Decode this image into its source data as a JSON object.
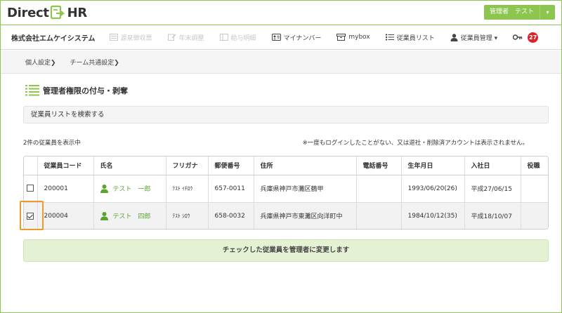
{
  "header": {
    "logo_left": "Direct",
    "logo_right": "HR",
    "admin_label": "管理者　テスト",
    "caret": "▾"
  },
  "nav": {
    "company": "株式会社エムケイシステム",
    "items": [
      {
        "label": "源泉徴収票",
        "icon": "document-icon",
        "disabled": true
      },
      {
        "label": "年末調整",
        "icon": "edit-icon",
        "disabled": true
      },
      {
        "label": "給与明細",
        "icon": "payslip-icon",
        "disabled": true
      },
      {
        "label": "マイナンバー",
        "icon": "id-card-icon",
        "disabled": false
      },
      {
        "label": "mybox",
        "icon": "box-icon",
        "disabled": false
      },
      {
        "label": "従業員リスト",
        "icon": "list-icon",
        "disabled": false
      },
      {
        "label": "従業員管理 ▾",
        "icon": "user-icon",
        "disabled": false
      }
    ],
    "notification_count": "27"
  },
  "subnav": {
    "items": [
      "個人設定❯",
      "チーム共通設定❯"
    ]
  },
  "main": {
    "title": "管理者権限の付与・剥奪",
    "search_label": "従業員リストを検索する",
    "count_text": "2件の従業員を表示中",
    "note_text": "※一度もログインしたことがない、又は退社・削除済アカウントは表示されません。",
    "submit_label": "チェックした従業員を管理者に変更します"
  },
  "table": {
    "headers": [
      "",
      "従業員コード",
      "氏名",
      "フリガナ",
      "郵便番号",
      "住所",
      "電話番号",
      "生年月日",
      "入社日",
      "役職"
    ],
    "rows": [
      {
        "checked": false,
        "code": "200001",
        "name": "テスト　一郎",
        "kana": "ﾃｽﾄ ｲﾁﾛｳ",
        "zip": "657-0011",
        "address": "兵庫県神戸市灘区鶴甲",
        "phone": "",
        "birth": "1993/06/20(26)",
        "joined": "平成27/06/15",
        "position": ""
      },
      {
        "checked": true,
        "code": "200004",
        "name": "テスト　四郎",
        "kana": "ﾃｽﾄ ｼﾛｳ",
        "zip": "658-0032",
        "address": "兵庫県神戸市東灘区向洋町中",
        "phone": "",
        "birth": "1984/10/12(35)",
        "joined": "平成18/10/07",
        "position": ""
      }
    ]
  },
  "colors": {
    "brand_green": "#8cc64f",
    "link_green": "#5aa32e",
    "badge_red": "#d9232d",
    "highlight_orange": "#f0972e"
  }
}
